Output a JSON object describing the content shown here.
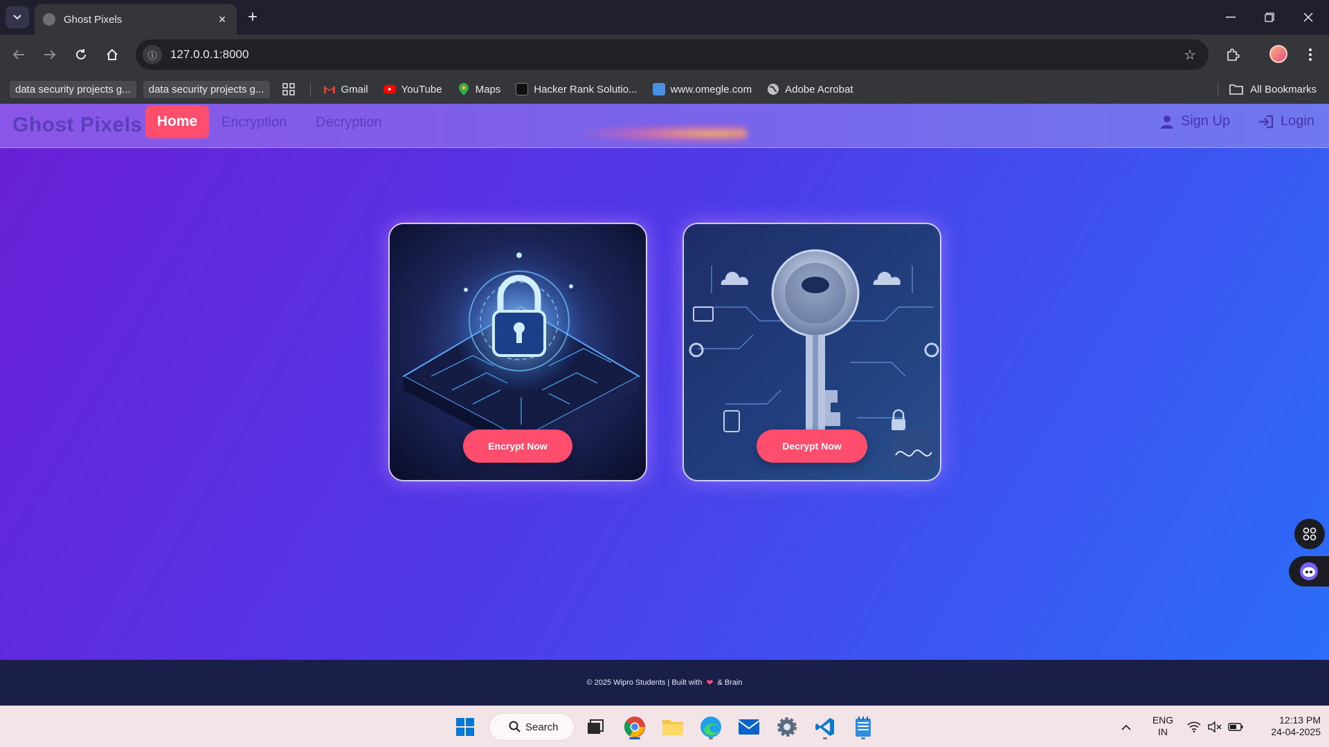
{
  "browser": {
    "tab_title": "Ghost Pixels",
    "url": "127.0.0.1:8000",
    "bookmarks": [
      {
        "label": "data security projects g...",
        "style": "pill"
      },
      {
        "label": "data security projects g...",
        "style": "pill"
      },
      {
        "label": "Gmail",
        "icon": "gmail-icon"
      },
      {
        "label": "YouTube",
        "icon": "youtube-icon"
      },
      {
        "label": "Maps",
        "icon": "maps-icon"
      },
      {
        "label": "Hacker Rank Solutio...",
        "icon": "hackerrank-icon"
      },
      {
        "label": "www.omegle.com",
        "icon": "omegle-icon"
      },
      {
        "label": "Adobe Acrobat",
        "icon": "globe-icon"
      }
    ],
    "all_bookmarks": "All Bookmarks"
  },
  "site": {
    "brand": "Ghost Pixels",
    "nav": {
      "home": "Home",
      "encryption": "Encryption",
      "decryption": "Decryption",
      "signup": "Sign Up",
      "login": "Login"
    },
    "cards": [
      {
        "button": "Encrypt Now",
        "image": "padlock-circuit-illustration"
      },
      {
        "button": "Decrypt Now",
        "image": "key-circuit-illustration"
      }
    ],
    "footer": {
      "prefix": "© 2025 Wipro Students | Built with",
      "heart": "❤",
      "suffix": "& Brain"
    }
  },
  "taskbar": {
    "search_label": "Search",
    "lang_top": "ENG",
    "lang_bottom": "IN",
    "time": "12:13 PM",
    "date": "24-04-2025"
  },
  "colors": {
    "accent": "#ff4d6d",
    "brand_text": "#5b3fb8",
    "page_gradient_start": "#6a1fd6",
    "page_gradient_end": "#2a6ef8",
    "footer_bg": "#1a1f4a"
  }
}
